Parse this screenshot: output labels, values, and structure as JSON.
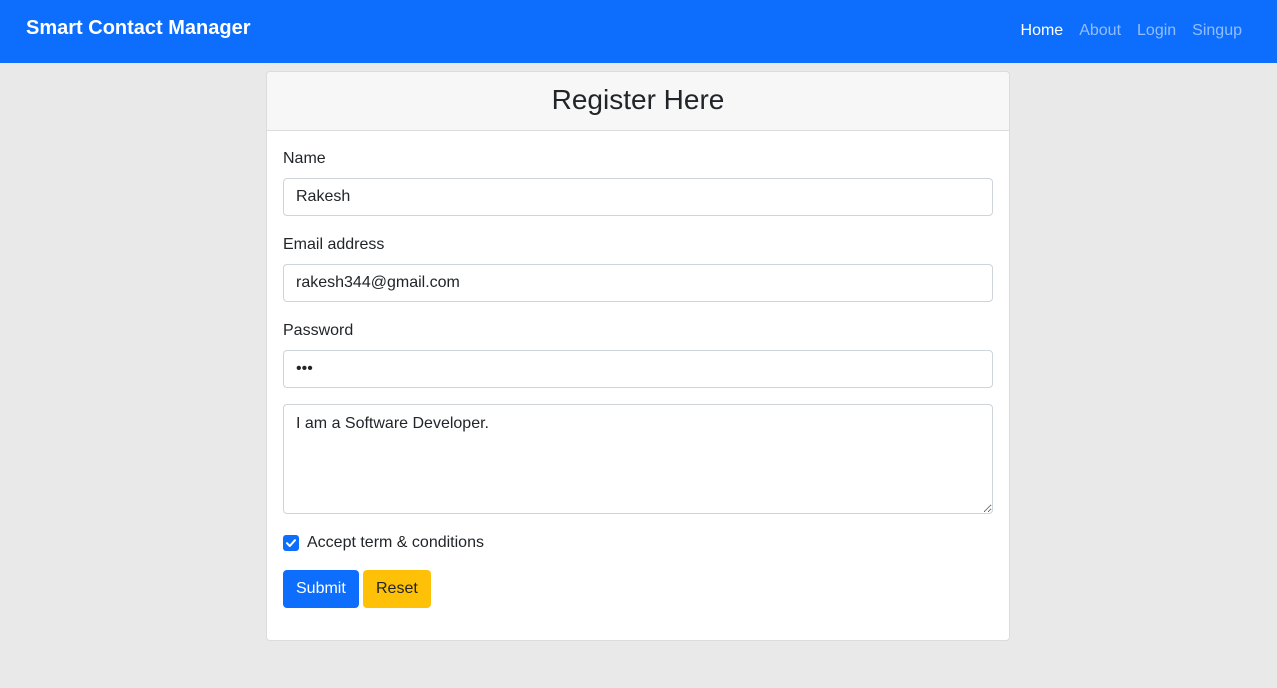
{
  "navbar": {
    "brand": "Smart Contact Manager",
    "links": [
      "Home",
      "About",
      "Login",
      "Singup"
    ],
    "active_link": "Home"
  },
  "form": {
    "title": "Register Here",
    "name_label": "Name",
    "name_value": "Rakesh",
    "email_label": "Email address",
    "email_value": "rakesh344@gmail.com",
    "password_label": "Password",
    "password_value": "•••",
    "about_value": "I am a Software Developer.",
    "terms_label": "Accept term & conditions",
    "terms_checked": true,
    "submit_label": "Submit",
    "reset_label": "Reset"
  },
  "colors": {
    "primary": "#0d6efd",
    "warning": "#ffc107",
    "background": "#e9e9e9"
  }
}
